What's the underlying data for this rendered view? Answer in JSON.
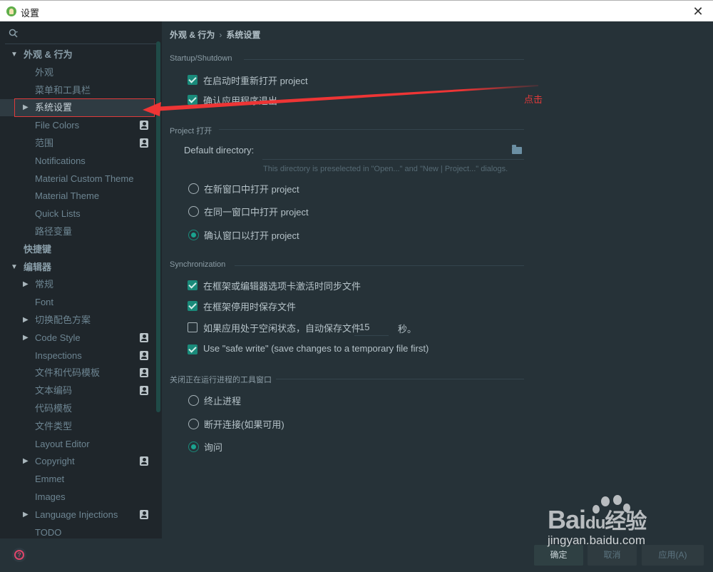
{
  "window": {
    "title": "设置",
    "close_icon": "close-icon"
  },
  "sidebar": {
    "search_placeholder": "",
    "items": [
      {
        "label": "外观 & 行为",
        "level": 0,
        "expanded": true,
        "arrow": "▼",
        "bold": true
      },
      {
        "label": "外观",
        "level": 1
      },
      {
        "label": "菜单和工具栏",
        "level": 1
      },
      {
        "label": "系统设置",
        "level": 1,
        "arrow": "▶",
        "selected": true
      },
      {
        "label": "File Colors",
        "level": 1,
        "badge": true
      },
      {
        "label": "范围",
        "level": 1,
        "badge": true
      },
      {
        "label": "Notifications",
        "level": 1
      },
      {
        "label": "Material Custom Theme",
        "level": 1
      },
      {
        "label": "Material Theme",
        "level": 1
      },
      {
        "label": "Quick Lists",
        "level": 1
      },
      {
        "label": "路径变量",
        "level": 1
      },
      {
        "label": "快捷键",
        "level": 0,
        "bold": true
      },
      {
        "label": "编辑器",
        "level": 0,
        "expanded": true,
        "arrow": "▼",
        "bold": true
      },
      {
        "label": "常规",
        "level": 1,
        "arrow": "▶"
      },
      {
        "label": "Font",
        "level": 1
      },
      {
        "label": "切换配色方案",
        "level": 1,
        "arrow": "▶"
      },
      {
        "label": "Code Style",
        "level": 1,
        "arrow": "▶",
        "badge": true
      },
      {
        "label": "Inspections",
        "level": 1,
        "badge": true
      },
      {
        "label": "文件和代码模板",
        "level": 1,
        "badge": true
      },
      {
        "label": "文本编码",
        "level": 1,
        "badge": true
      },
      {
        "label": "代码模板",
        "level": 1
      },
      {
        "label": "文件类型",
        "level": 1
      },
      {
        "label": "Layout Editor",
        "level": 1
      },
      {
        "label": "Copyright",
        "level": 1,
        "arrow": "▶",
        "badge": true
      },
      {
        "label": "Emmet",
        "level": 1
      },
      {
        "label": "Images",
        "level": 1
      },
      {
        "label": "Language Injections",
        "level": 1,
        "arrow": "▶",
        "badge": true
      },
      {
        "label": "TODO",
        "level": 1
      }
    ]
  },
  "breadcrumb": {
    "parent": "外观 & 行为",
    "separator": "›",
    "current": "系统设置"
  },
  "sections": {
    "startup": {
      "title": "Startup/Shutdown",
      "reopen_project": {
        "label": "在启动时重新打开 project",
        "checked": true
      },
      "confirm_exit": {
        "label": "确认应用程序退出",
        "checked": true
      }
    },
    "project_open": {
      "title": "Project 打开",
      "default_directory_label": "Default directory:",
      "default_directory_value": "",
      "hint": "This directory is preselected in \"Open...\" and \"New | Project...\" dialogs.",
      "options": [
        {
          "label": "在新窗口中打开 project",
          "selected": false
        },
        {
          "label": "在同一窗口中打开 project",
          "selected": false
        },
        {
          "label": "确认窗口以打开 project",
          "selected": true
        }
      ]
    },
    "sync": {
      "title": "Synchronization",
      "sync_on_activation": {
        "label": "在框架或编辑器选项卡激活时同步文件",
        "checked": true
      },
      "save_on_deactivation": {
        "label": "在框架停用时保存文件",
        "checked": true
      },
      "autosave_idle": {
        "label": "如果应用处于空闲状态，自动保存文件",
        "checked": false,
        "seconds": "15",
        "unit": "秒。"
      },
      "safe_write": {
        "label": "Use \"safe write\" (save changes to a temporary file first)",
        "checked": true
      }
    },
    "close_tool_window": {
      "title": "关闭正在运行进程的工具窗口",
      "options": [
        {
          "label": "终止进程",
          "selected": false
        },
        {
          "label": "断开连接(如果可用)",
          "selected": false
        },
        {
          "label": "询问",
          "selected": true
        }
      ]
    }
  },
  "buttons": {
    "ok": "确定",
    "cancel": "取消",
    "apply": "应用(A)"
  },
  "annotation": {
    "text": "点击",
    "color": "#e03a3a"
  },
  "watermark": {
    "brand": "Bai",
    "brand_du": "du",
    "brand_cn": "经验",
    "url": "jingyan.baidu.com"
  },
  "colors": {
    "accent": "#1a8a7a",
    "sidebar_bg": "#1f262b",
    "main_bg": "#263238",
    "annotation_red": "#e03a3a"
  }
}
